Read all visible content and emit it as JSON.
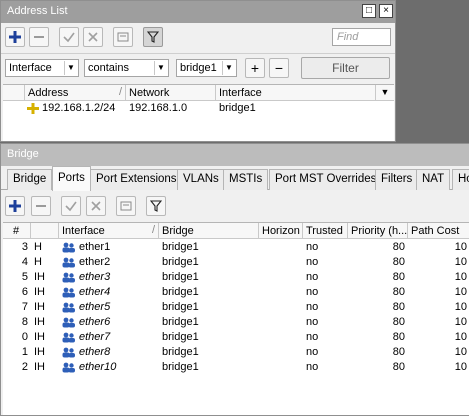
{
  "address_list": {
    "title": "Address List",
    "title_buttons": [
      "□",
      "×"
    ],
    "find_placeholder": "Find",
    "filter": {
      "field": "Interface",
      "operator": "contains",
      "value": "bridge1",
      "add_label": "+",
      "remove_label": "−",
      "filter_label": "Filter"
    },
    "columns": [
      "Address",
      "Network",
      "Interface"
    ],
    "rows": [
      {
        "address": "192.168.1.2/24",
        "network": "192.168.1.0",
        "interface": "bridge1"
      }
    ]
  },
  "bridge": {
    "title": "Bridge",
    "tabs": [
      "Bridge",
      "Ports",
      "Port Extensions",
      "VLANs",
      "MSTIs",
      "Port MST Overrides",
      "Filters",
      "NAT",
      "Ho"
    ],
    "active_tab": "Ports",
    "columns": [
      "#",
      "",
      "Interface",
      "Bridge",
      "Horizon",
      "Trusted",
      "Priority (h...",
      "Path Cost"
    ],
    "rows": [
      {
        "num": "3",
        "flags": "H",
        "interface": "ether1",
        "italic": false,
        "bridge": "bridge1",
        "horizon": "",
        "trusted": "no",
        "priority": "80",
        "path_cost": "10"
      },
      {
        "num": "4",
        "flags": "H",
        "interface": "ether2",
        "italic": false,
        "bridge": "bridge1",
        "horizon": "",
        "trusted": "no",
        "priority": "80",
        "path_cost": "10"
      },
      {
        "num": "5",
        "flags": "IH",
        "interface": "ether3",
        "italic": true,
        "bridge": "bridge1",
        "horizon": "",
        "trusted": "no",
        "priority": "80",
        "path_cost": "10"
      },
      {
        "num": "6",
        "flags": "IH",
        "interface": "ether4",
        "italic": true,
        "bridge": "bridge1",
        "horizon": "",
        "trusted": "no",
        "priority": "80",
        "path_cost": "10"
      },
      {
        "num": "7",
        "flags": "IH",
        "interface": "ether5",
        "italic": true,
        "bridge": "bridge1",
        "horizon": "",
        "trusted": "no",
        "priority": "80",
        "path_cost": "10"
      },
      {
        "num": "8",
        "flags": "IH",
        "interface": "ether6",
        "italic": true,
        "bridge": "bridge1",
        "horizon": "",
        "trusted": "no",
        "priority": "80",
        "path_cost": "10"
      },
      {
        "num": "0",
        "flags": "IH",
        "interface": "ether7",
        "italic": true,
        "bridge": "bridge1",
        "horizon": "",
        "trusted": "no",
        "priority": "80",
        "path_cost": "10"
      },
      {
        "num": "1",
        "flags": "IH",
        "interface": "ether8",
        "italic": true,
        "bridge": "bridge1",
        "horizon": "",
        "trusted": "no",
        "priority": "80",
        "path_cost": "10"
      },
      {
        "num": "2",
        "flags": "IH",
        "interface": "ether10",
        "italic": true,
        "bridge": "bridge1",
        "horizon": "",
        "trusted": "no",
        "priority": "80",
        "path_cost": "10"
      }
    ]
  },
  "colors": {
    "add_icon": "#1d3f9a",
    "address_icon": "#d6b100",
    "interface_icon": "#2e5fb8"
  }
}
